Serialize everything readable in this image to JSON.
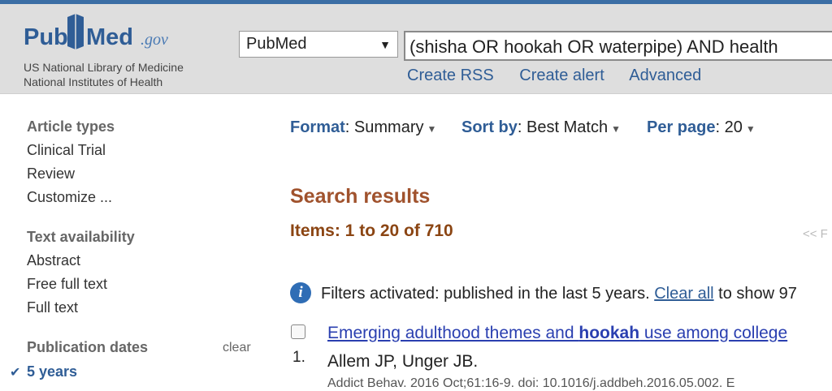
{
  "header": {
    "logo_pub": "Pub",
    "logo_med": "Med",
    "logo_gov": ".gov",
    "nlm_line1": "US National Library of Medicine",
    "nlm_line2": "National Institutes of Health",
    "database_select": "PubMed",
    "search_query": "(shisha OR hookah OR waterpipe) AND health",
    "links": [
      "Create RSS",
      "Create alert",
      "Advanced"
    ]
  },
  "sidebar": {
    "article_types": {
      "heading": "Article types",
      "items": [
        "Clinical Trial",
        "Review",
        "Customize ..."
      ]
    },
    "text_availability": {
      "heading": "Text availability",
      "items": [
        "Abstract",
        "Free full text",
        "Full text"
      ]
    },
    "publication_dates": {
      "heading": "Publication dates",
      "clear": "clear",
      "selected": "5 years"
    }
  },
  "display": {
    "format_label": "Format",
    "format_value": "Summary",
    "sort_label": "Sort by",
    "sort_value": "Best Match",
    "perpage_label": "Per page",
    "perpage_value": "20"
  },
  "results": {
    "title": "Search results",
    "items": "Items: 1 to 20 of 710",
    "pager": "<< F",
    "filter_text": "Filters activated: published in the last 5 years.",
    "clear_all": "Clear all",
    "filter_suffix": "to show 97"
  },
  "articles": [
    {
      "number": "1.",
      "title_before": "Emerging adulthood themes and ",
      "title_bold": "hookah",
      "title_after": " use among college",
      "authors": "Allem JP, Unger JB.",
      "citation": "Addict Behav. 2016 Oct;61:16-9. doi: 10.1016/j.addbeh.2016.05.002. E"
    }
  ],
  "colors": {
    "brand_blue": "#2f5d96",
    "results_brown": "#a0522d",
    "header_bg": "#dedede",
    "link_blue": "#2a3fb0"
  }
}
